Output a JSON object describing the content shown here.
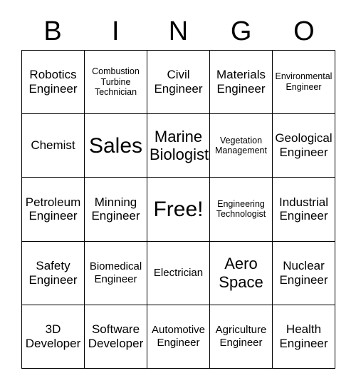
{
  "header": {
    "letters": [
      "B",
      "I",
      "N",
      "G",
      "O"
    ]
  },
  "grid": {
    "rows": 5,
    "columns": 5,
    "cells": [
      {
        "text": "Robotics\nEngineer",
        "size": "md"
      },
      {
        "text": "Combustion\nTurbine\nTechnician",
        "size": "xs"
      },
      {
        "text": "Civil\nEngineer",
        "size": "md"
      },
      {
        "text": "Materials\nEngineer",
        "size": "md"
      },
      {
        "text": "Environmental\nEngineer",
        "size": "xs"
      },
      {
        "text": "Chemist",
        "size": "md"
      },
      {
        "text": "Sales",
        "size": "xl"
      },
      {
        "text": "Marine\nBiologist",
        "size": "lg"
      },
      {
        "text": "Vegetation\nManagement",
        "size": "xs"
      },
      {
        "text": "Geological\nEngineer",
        "size": "md"
      },
      {
        "text": "Petroleum\nEngineer",
        "size": "md"
      },
      {
        "text": "Minning\nEngineer",
        "size": "md"
      },
      {
        "text": "Free!",
        "size": "xl"
      },
      {
        "text": "Engineering\nTechnologist",
        "size": "xs"
      },
      {
        "text": "Industrial\nEngineer",
        "size": "md"
      },
      {
        "text": "Safety\nEngineer",
        "size": "md"
      },
      {
        "text": "Biomedical\nEngineer",
        "size": "sm"
      },
      {
        "text": "Electrician",
        "size": "sm"
      },
      {
        "text": "Aero\nSpace",
        "size": "lg"
      },
      {
        "text": "Nuclear\nEngineer",
        "size": "md"
      },
      {
        "text": "3D\nDeveloper",
        "size": "md"
      },
      {
        "text": "Software\nDeveloper",
        "size": "md"
      },
      {
        "text": "Automotive\nEngineer",
        "size": "sm"
      },
      {
        "text": "Agriculture\nEngineer",
        "size": "sm"
      },
      {
        "text": "Health\nEngineer",
        "size": "md"
      }
    ]
  },
  "colors": {
    "background": "#ffffff",
    "border": "#000000",
    "text": "#000000"
  }
}
